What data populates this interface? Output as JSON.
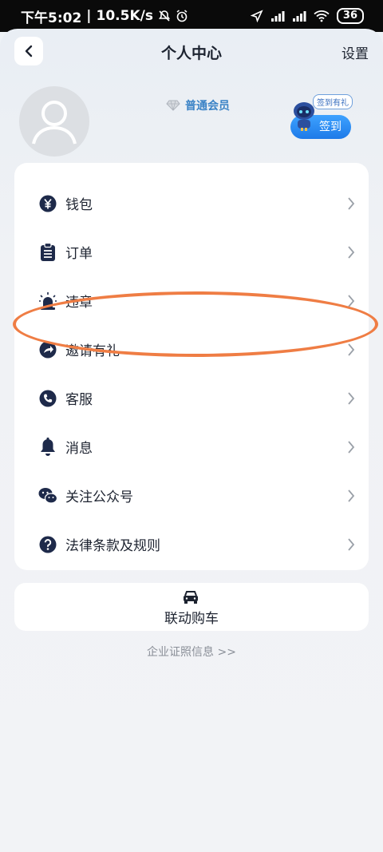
{
  "status_bar": {
    "time": "下午5:02",
    "speed": "10.5K/s",
    "battery": "36"
  },
  "header": {
    "title": "个人中心",
    "settings": "设置"
  },
  "profile": {
    "member_level": "普通会员",
    "checkin_tag": "签到有礼",
    "checkin_button": "签到"
  },
  "menu": {
    "items": [
      {
        "label": "钱包",
        "icon": "yuan-icon"
      },
      {
        "label": "订单",
        "icon": "clipboard-icon"
      },
      {
        "label": "违章",
        "icon": "siren-icon"
      },
      {
        "label": "邀请有礼",
        "icon": "share-icon"
      },
      {
        "label": "客服",
        "icon": "phone-icon"
      },
      {
        "label": "消息",
        "icon": "bell-icon"
      },
      {
        "label": "关注公众号",
        "icon": "wechat-icon"
      },
      {
        "label": "法律条款及规则",
        "icon": "question-icon"
      }
    ]
  },
  "buy_car": {
    "label": "联动购车"
  },
  "footer": {
    "company_info": "企业证照信息 >>"
  },
  "colors": {
    "accent": "#1d7ae8",
    "icon": "#1e2a4a",
    "highlight": "#ef7d44"
  }
}
